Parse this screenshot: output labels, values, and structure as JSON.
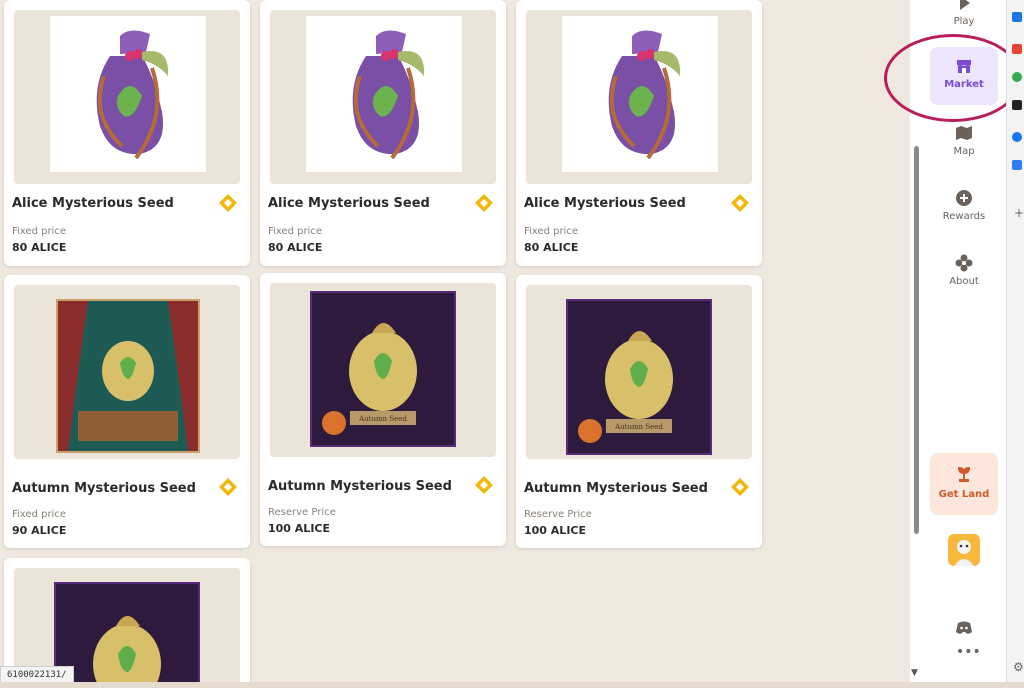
{
  "cards": [
    {
      "name": "Alice Mysterious Seed",
      "price_label": "Fixed price",
      "price": "80 ALICE"
    },
    {
      "name": "Alice Mysterious Seed",
      "price_label": "Fixed price",
      "price": "80 ALICE"
    },
    {
      "name": "Alice Mysterious Seed",
      "price_label": "Fixed price",
      "price": "80 ALICE"
    },
    {
      "name": "Autumn Mysterious Seed",
      "price_label": "Fixed price",
      "price": "90 ALICE"
    },
    {
      "name": "Autumn Mysterious Seed",
      "price_label": "Reserve Price",
      "price": "100 ALICE"
    },
    {
      "name": "Autumn Mysterious Seed",
      "price_label": "Reserve Price",
      "price": "100 ALICE"
    }
  ],
  "artwork_labels": {
    "autumn": "Autumn Seed"
  },
  "sidebar": {
    "play": "Play",
    "market": "Market",
    "map": "Map",
    "rewards": "Rewards",
    "about": "About",
    "get_land": "Get Land"
  },
  "status_url": "6100022131/",
  "colors": {
    "accent": "#7b4bd6",
    "annotation": "#b81e5b",
    "chain": "#f0b90b",
    "get_land": "#d05b2a"
  }
}
